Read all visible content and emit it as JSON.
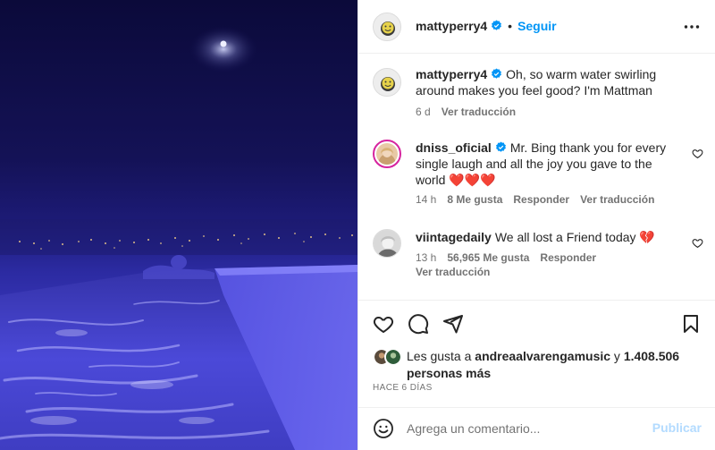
{
  "post": {
    "author": "mattyperry4",
    "follow_label": "Seguir",
    "separator": "•",
    "more_icon": "more-horizontal-icon",
    "verified_icon": "verified-badge-icon"
  },
  "comments": [
    {
      "username": "mattyperry4",
      "verified": true,
      "text": "Oh, so warm water swirling around makes you feel good? I'm Mattman",
      "time": "6 d",
      "likes": "",
      "reply": "",
      "translate": "Ver traducción"
    },
    {
      "username": "dniss_oficial",
      "verified": true,
      "text": "Mr. Bing thank you for every single laugh and all the joy you gave to the world ❤️❤️❤️",
      "time": "14 h",
      "likes": "8 Me gusta",
      "reply": "Responder",
      "translate": "Ver traducción"
    },
    {
      "username": "viintagedaily",
      "verified": false,
      "text": "We all lost a Friend today 💔",
      "time": "13 h",
      "likes": "56,965 Me gusta",
      "reply": "Responder",
      "translate": "Ver traducción"
    }
  ],
  "actions": {
    "like_icon": "heart-icon",
    "comment_icon": "comment-icon",
    "share_icon": "send-icon",
    "save_icon": "bookmark-icon"
  },
  "likes_summary": {
    "prefix": "Les gusta a",
    "user": "andreaalvarengamusic",
    "connector": "y",
    "count": "1.408.506",
    "suffix": "personas más"
  },
  "posted_ago": "HACE 6 DÍAS",
  "composer": {
    "placeholder": "Agrega un comentario...",
    "post_label": "Publicar",
    "emoji_icon": "emoji-icon"
  },
  "colors": {
    "accent": "#0095f6",
    "post_disabled": "#b3dbff",
    "muted": "#737373",
    "media_tint": "#3d3ac4"
  }
}
